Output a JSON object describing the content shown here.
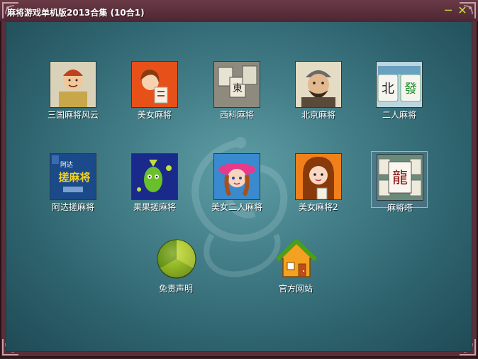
{
  "window": {
    "title": "麻将游戏单机版2013合集 (10合1)",
    "minimize_glyph": "─",
    "close_glyph": "✕"
  },
  "games": [
    {
      "label": "三国麻将风云",
      "icon": "three-kingdoms-icon"
    },
    {
      "label": "美女麻将",
      "icon": "beauty-mahjong-icon"
    },
    {
      "label": "西科麻将",
      "icon": "xike-mahjong-icon"
    },
    {
      "label": "北京麻将",
      "icon": "beijing-mahjong-icon"
    },
    {
      "label": "二人麻将",
      "icon": "two-player-mahjong-icon"
    },
    {
      "label": "阿达搓麻将",
      "icon": "ada-mahjong-icon"
    },
    {
      "label": "果果搓麻将",
      "icon": "guoguo-mahjong-icon"
    },
    {
      "label": "美女二人麻将",
      "icon": "beauty-two-player-icon"
    },
    {
      "label": "美女麻将2",
      "icon": "beauty-mahjong-2-icon"
    },
    {
      "label": "麻将塔",
      "icon": "mahjong-tower-icon",
      "selected": true
    }
  ],
  "actions": {
    "disclaimer_label": "免责声明",
    "website_label": "官方网站"
  },
  "tile_text": {
    "east": "東",
    "north": "北",
    "fa": "發",
    "dragon": "龍",
    "ada_brand": "阿达",
    "ada_title": "搓麻将"
  },
  "colors": {
    "accent": "#c6dc3a",
    "frame": "#5a2f3a",
    "background": "#437e88"
  }
}
